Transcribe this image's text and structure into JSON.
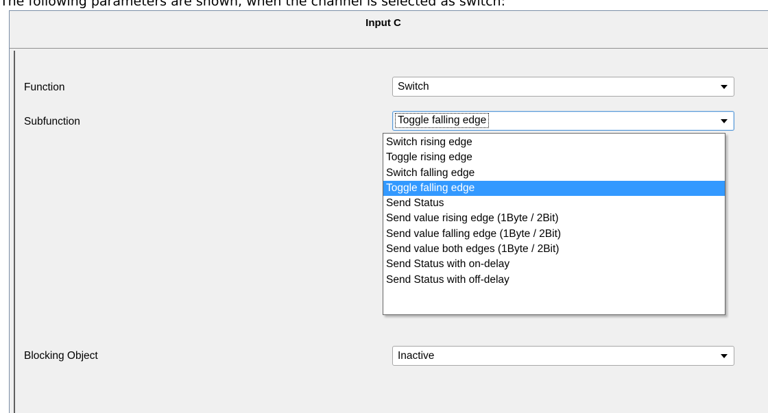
{
  "caption": "The following parameters are shown, when the channel is selected as switch:",
  "window": {
    "title": "Input C"
  },
  "params": {
    "function": {
      "label": "Function",
      "value": "Switch"
    },
    "subfunction": {
      "label": "Subfunction",
      "value": "Toggle falling edge",
      "options": [
        "Switch rising edge",
        "Toggle rising edge",
        "Switch falling edge",
        "Toggle falling edge",
        "Send Status",
        "Send value rising edge (1Byte / 2Bit)",
        "Send value falling edge (1Byte / 2Bit)",
        "Send value both edges (1Byte / 2Bit)",
        "Send Status with on-delay",
        "Send Status with off-delay"
      ],
      "selected_index": 3
    },
    "blocking": {
      "label": "Blocking Object",
      "value": "Inactive"
    }
  },
  "colors": {
    "selection": "#3399ff",
    "window_bg": "#f0f0f0"
  },
  "icons": {
    "dropdown_arrow": "chevron-down-icon"
  }
}
